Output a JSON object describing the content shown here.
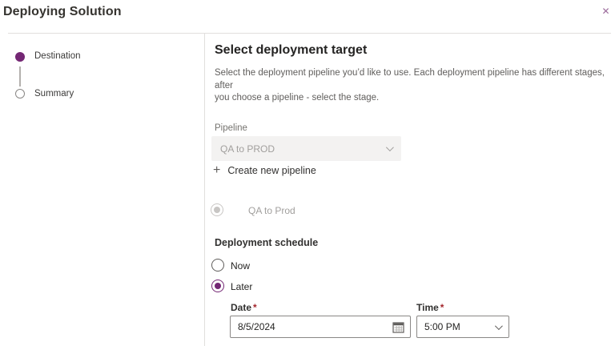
{
  "header": {
    "title": "Deploying Solution"
  },
  "icons": {
    "close": "✕",
    "plus": "+"
  },
  "colors": {
    "accent_purple": "#742774",
    "close_purple": "#9b6b9b",
    "required_red": "#a4262c",
    "disabled_bg": "#f3f2f1",
    "disabled_text": "#a19f9d",
    "divider": "#e1dfdd",
    "text_primary": "#252423",
    "text_secondary": "#605e5c"
  },
  "stepper": {
    "steps": [
      {
        "label": "Destination",
        "state": "current"
      },
      {
        "label": "Summary",
        "state": "upcoming"
      }
    ]
  },
  "content": {
    "heading": "Select deployment target",
    "description_line1": "Select the deployment pipeline you’d like to use. Each deployment pipeline has different stages, after",
    "description_line2": "you choose a pipeline - select the stage.",
    "pipeline_field": {
      "label": "Pipeline",
      "value": "QA to PROD",
      "disabled": true
    },
    "create_pipeline_label": "Create new pipeline",
    "stage_radio": {
      "label": "QA to Prod",
      "selected": true,
      "disabled": true
    },
    "schedule": {
      "heading": "Deployment schedule",
      "now_option": {
        "label": "Now",
        "selected": false
      },
      "later_option": {
        "label": "Later",
        "selected": true
      },
      "date_field": {
        "label": "Date",
        "required": "*",
        "value": "8/5/2024"
      },
      "time_field": {
        "label": "Time",
        "required": "*",
        "value": "5:00 PM"
      }
    }
  }
}
